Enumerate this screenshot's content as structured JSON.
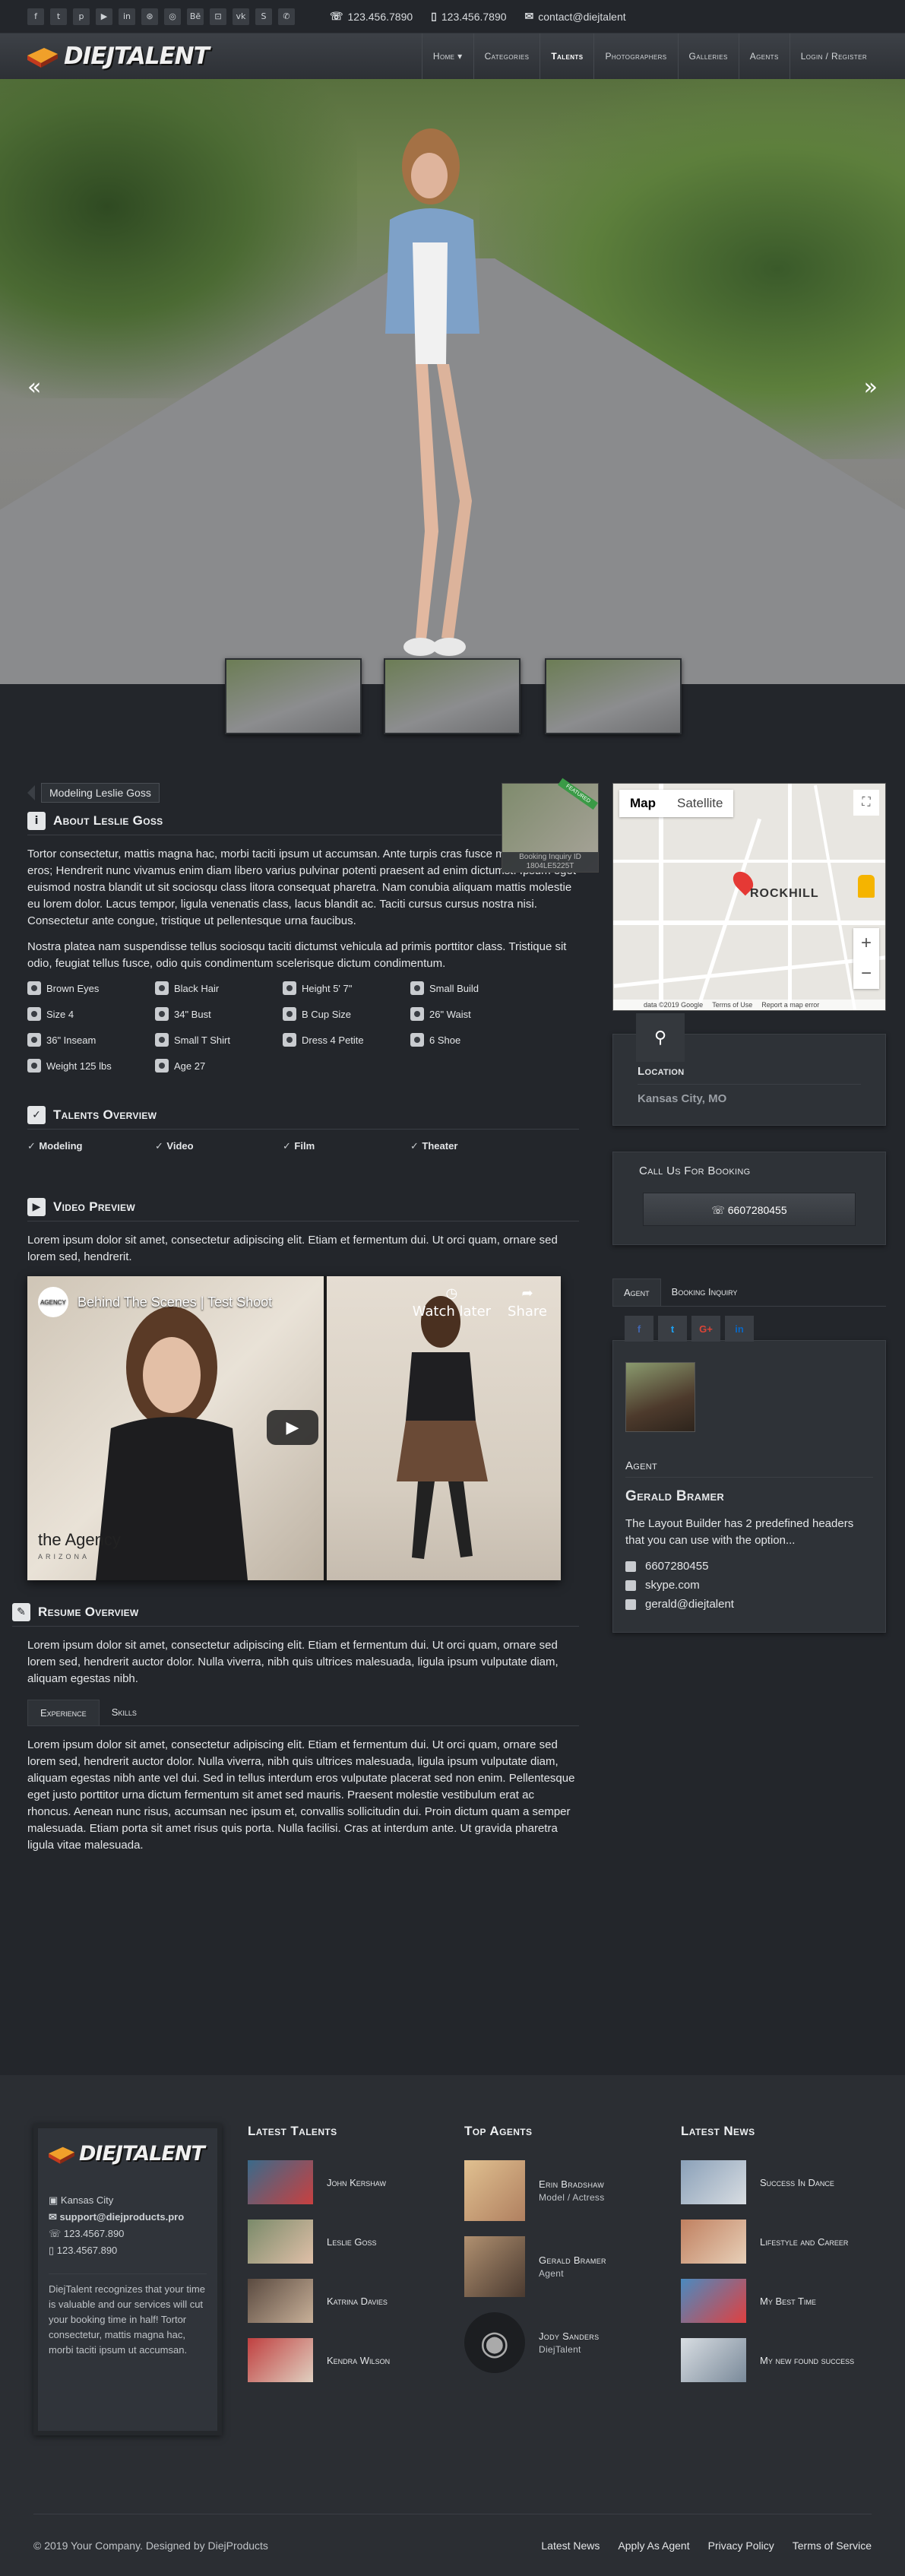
{
  "topbar": {
    "social_icons": [
      "f",
      "t",
      "p",
      "▶",
      "in",
      "⊛",
      "◎",
      "Bē",
      "⊡",
      "vk",
      "S",
      "✆"
    ],
    "phone1": "123.456.7890",
    "phone2": "123.456.7890",
    "email": "contact@diejtalent"
  },
  "header": {
    "logo_text": "DIEJTALENT",
    "nav": [
      "Home ▾",
      "Categories",
      "Talents",
      "Photographers",
      "Galleries",
      "Agents",
      "Login / Register"
    ]
  },
  "profile": {
    "tag": "Modeling Leslie Goss",
    "about_title": "About Leslie Goss",
    "about_p1": "Tortor consectetur, mattis magna hac, morbi taciti ipsum ut accumsan. Ante turpis cras fusce metus semper eros; Hendrerit nunc vivamus enim diam libero varius pulvinar potenti praesent ad enim dictumst. Ipsum eget euismod nostra blandit ut sit sociosqu class litora consequat pharetra. Nam conubia aliquam mattis molestie eu lorem dolor. Lacus tempor, ligula venenatis class, lacus blandit ac. Taciti cursus cursus nostra nisi. Consectetur ante congue, tristique ut pellentesque urna faucibus.",
    "about_p2": "Nostra platea nam suspendisse tellus sociosqu taciti dictumst vehicula ad primis porttitor class. Tristique sit odio, feugiat tellus fusce, odio quis condimentum scelerisque dictum condimentum.",
    "attributes": [
      "Brown Eyes",
      "Black Hair",
      "Height 5' 7\"",
      "Small Build",
      "Size 4",
      "34\" Bust",
      "B Cup Size",
      "26\" Waist",
      "36\" Inseam",
      "Small T Shirt",
      "Dress 4 Petite",
      "6 Shoe",
      "Weight 125 lbs",
      "Age 27"
    ],
    "overview_title": "Talents Overview",
    "overview": [
      "Modeling",
      "Video",
      "Film",
      "Theater"
    ],
    "video_title": "Video Preview",
    "video_text": "Lorem ipsum dolor sit amet, consectetur adipiscing elit. Etiam et fermentum dui. Ut orci quam, ornare sed lorem sed, hendrerit.",
    "video_caption": "Behind The Scenes | Test Shoot",
    "watch_later": "Watch later",
    "share": "Share",
    "agency": "the Agency",
    "agency_sub": "ARIZONA",
    "resume_title": "Resume Overview",
    "resume_text": "Lorem ipsum dolor sit amet, consectetur adipiscing elit. Etiam et fermentum dui. Ut orci quam, ornare sed lorem sed, hendrerit auctor dolor. Nulla viverra, nibh quis ultrices malesuada, ligula ipsum vulputate diam, aliquam egestas nibh.",
    "resume_tabs": [
      "Experience",
      "Skills"
    ],
    "experience_text": "Lorem ipsum dolor sit amet, consectetur adipiscing elit. Etiam et fermentum dui. Ut orci quam, ornare sed lorem sed, hendrerit auctor dolor. Nulla viverra, nibh quis ultrices malesuada, ligula ipsum vulputate diam, aliquam egestas nibh ante vel dui. Sed in tellus interdum eros vulputate placerat sed non enim. Pellentesque eget justo porttitor urna dictum fermentum sit amet sed mauris. Praesent molestie vestibulum erat ac rhoncus. Aenean nunc risus, accumsan nec ipsum et, convallis sollicitudin dui. Proin dictum quam a semper malesuada. Etiam porta sit amet risus quis porta. Nulla facilisi. Cras at interdum ante. Ut gravida pharetra ligula vitae malesuada."
  },
  "sidebar": {
    "booking_thumb_label": "Booking Inquiry ID 1804LE5225T",
    "ribbon": "FEATURED",
    "map_btn_map": "Map",
    "map_btn_sat": "Satellite",
    "map_label": "ROCKHILL",
    "map_footer": [
      "data ©2019 Google",
      "Terms of Use",
      "Report a map error"
    ],
    "location_title": "Location",
    "location_value": "Kansas City, MO",
    "booking_title": "Call Us For Booking",
    "booking_phone": "6607280455",
    "agent_tabs": [
      "Agent",
      "Booking Inquiry"
    ],
    "agent_social": [
      "f",
      "t",
      "G+",
      "in"
    ],
    "agent_label": "Agent",
    "agent_name": "Gerald Bramer",
    "agent_desc": "The Layout Builder has 2 predefined headers that you can use with the option...",
    "agent_phone": "6607280455",
    "agent_skype": "skype.com",
    "agent_email": "gerald@diejtalent"
  },
  "footer": {
    "logo_text": "DIEJTALENT",
    "city": "Kansas City",
    "email": "support@diejproducts.pro",
    "phone1": "123.4567.890",
    "phone2": "123.4567.890",
    "about": "DiejTalent recognizes that your time is valuable and our services will cut your booking time in half! Tortor consectetur, mattis magna hac, morbi taciti ipsum ut accumsan.",
    "latest_talents_title": "Latest Talents",
    "latest_talents": [
      "John Kershaw",
      "Leslie Goss",
      "Katrina Davies",
      "Kendra Wilson"
    ],
    "top_agents_title": "Top Agents",
    "top_agents": [
      {
        "name": "Erin Bradshaw",
        "role": "Model / Actress"
      },
      {
        "name": "Gerald Bramer",
        "role": "Agent"
      },
      {
        "name": "Jody Sanders",
        "role": "DiejTalent"
      }
    ],
    "latest_news_title": "Latest News",
    "latest_news": [
      "Success In Dance",
      "Lifestyle and Career",
      "My Best Time",
      "My new found success"
    ],
    "copyright": "© 2019 Your Company. Designed by DiejProducts",
    "links": [
      "Latest News",
      "Apply As Agent",
      "Privacy Policy",
      "Terms of Service"
    ]
  }
}
